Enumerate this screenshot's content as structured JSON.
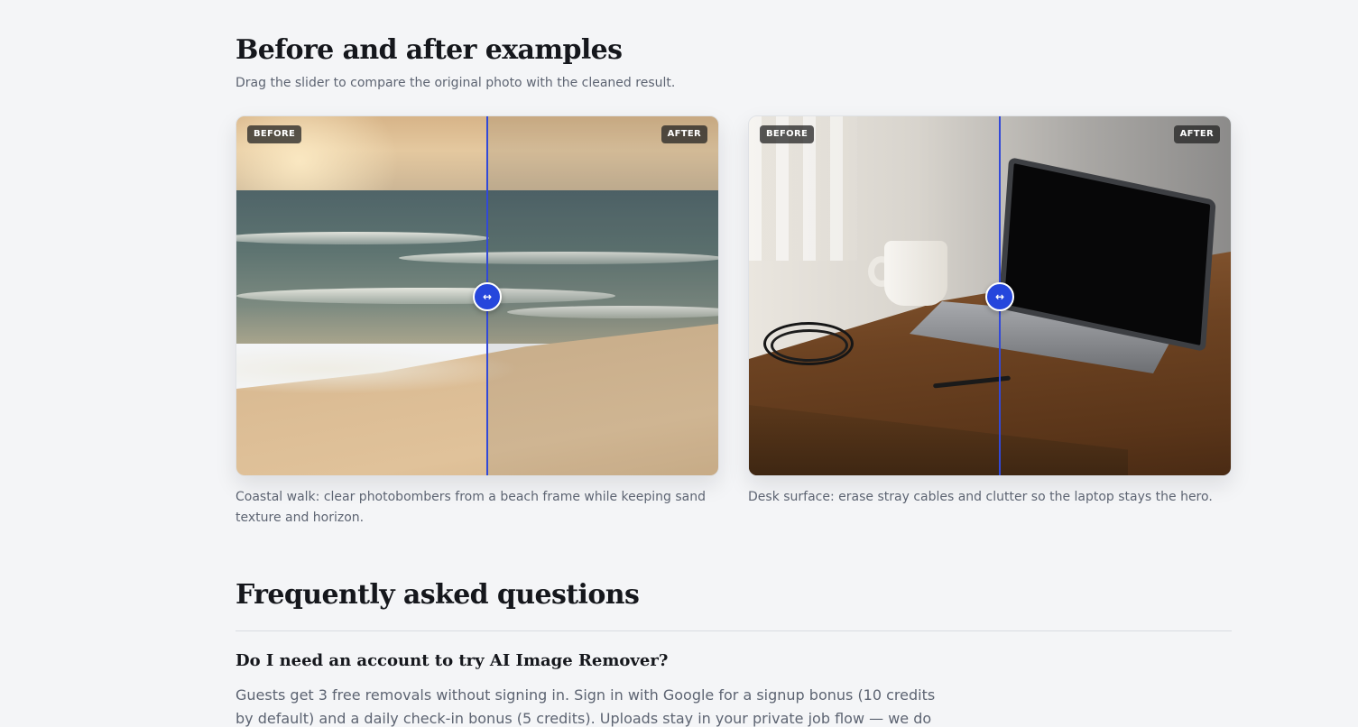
{
  "examples": {
    "title": "Before and after examples",
    "subtitle": "Drag the slider to compare the original photo with the cleaned result.",
    "items": [
      {
        "before_label": "BEFORE",
        "after_label": "AFTER",
        "caption": "Coastal walk: clear photobombers from a beach frame while keeping sand texture and horizon.",
        "slider_position_percent": 52
      },
      {
        "before_label": "BEFORE",
        "after_label": "AFTER",
        "caption": "Desk surface: erase stray cables and clutter so the laptop stays the hero.",
        "slider_position_percent": 52
      }
    ],
    "handle_glyph": "↔"
  },
  "faq": {
    "title": "Frequently asked questions",
    "items": [
      {
        "question": "Do I need an account to try AI Image Remover?",
        "answer": "Guests get 3 free removals without signing in. Sign in with Google for a signup bonus (10 credits by default) and a daily check-in bonus (5 credits). Uploads stay in your private job flow — we do not"
      }
    ]
  },
  "colors": {
    "accent": "#2546dc",
    "page_background": "#f4f5f7",
    "muted_text": "#5d6472"
  }
}
